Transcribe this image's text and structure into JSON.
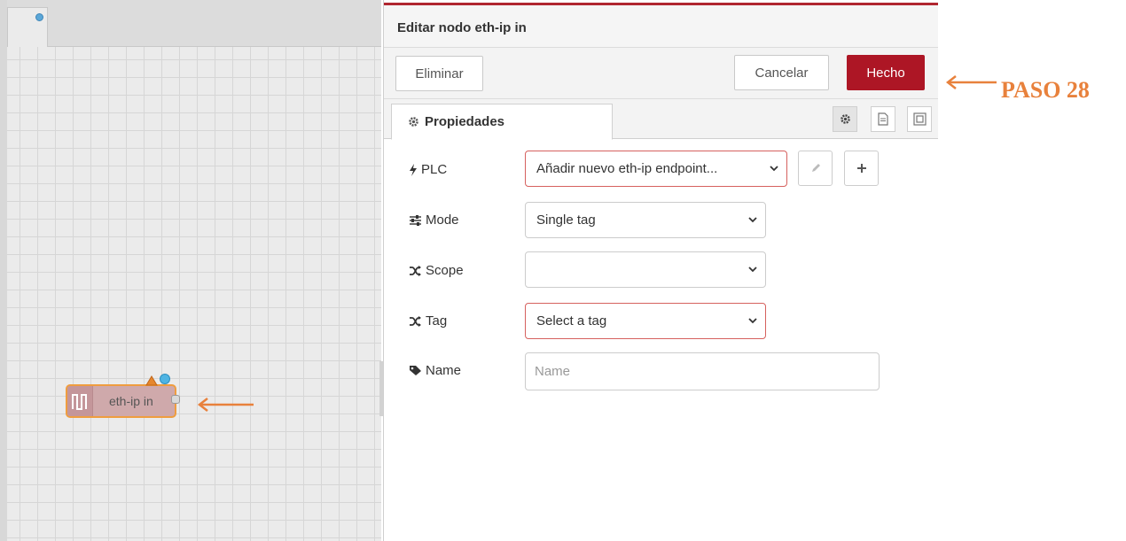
{
  "canvas": {
    "node": {
      "label": "eth-ip in",
      "icon": "pulse-icon"
    }
  },
  "tray": {
    "title": "Editar nodo eth-ip in",
    "buttons": {
      "delete": "Eliminar",
      "cancel": "Cancelar",
      "done": "Hecho"
    },
    "tabs": {
      "properties": "Propiedades",
      "icons": [
        "gear-icon",
        "document-icon",
        "frame-icon"
      ]
    },
    "form": {
      "plc": {
        "label": "PLC",
        "value": "Añadir nuevo eth-ip endpoint...",
        "icon": "bolt-icon"
      },
      "mode": {
        "label": "Mode",
        "value": "Single tag",
        "icon": "sliders-icon"
      },
      "scope": {
        "label": "Scope",
        "value": "",
        "icon": "shuffle-icon"
      },
      "tag": {
        "label": "Tag",
        "value": "Select a tag",
        "icon": "shuffle-icon"
      },
      "name": {
        "label": "Name",
        "placeholder": "Name",
        "icon": "tag-icon"
      }
    }
  },
  "annotation": {
    "step": "PASO 28"
  },
  "colors": {
    "accent": "#ad1625",
    "annotation": "#e8813c",
    "node_border": "#ef9d3f",
    "node_fill": "#cfa9ab"
  }
}
